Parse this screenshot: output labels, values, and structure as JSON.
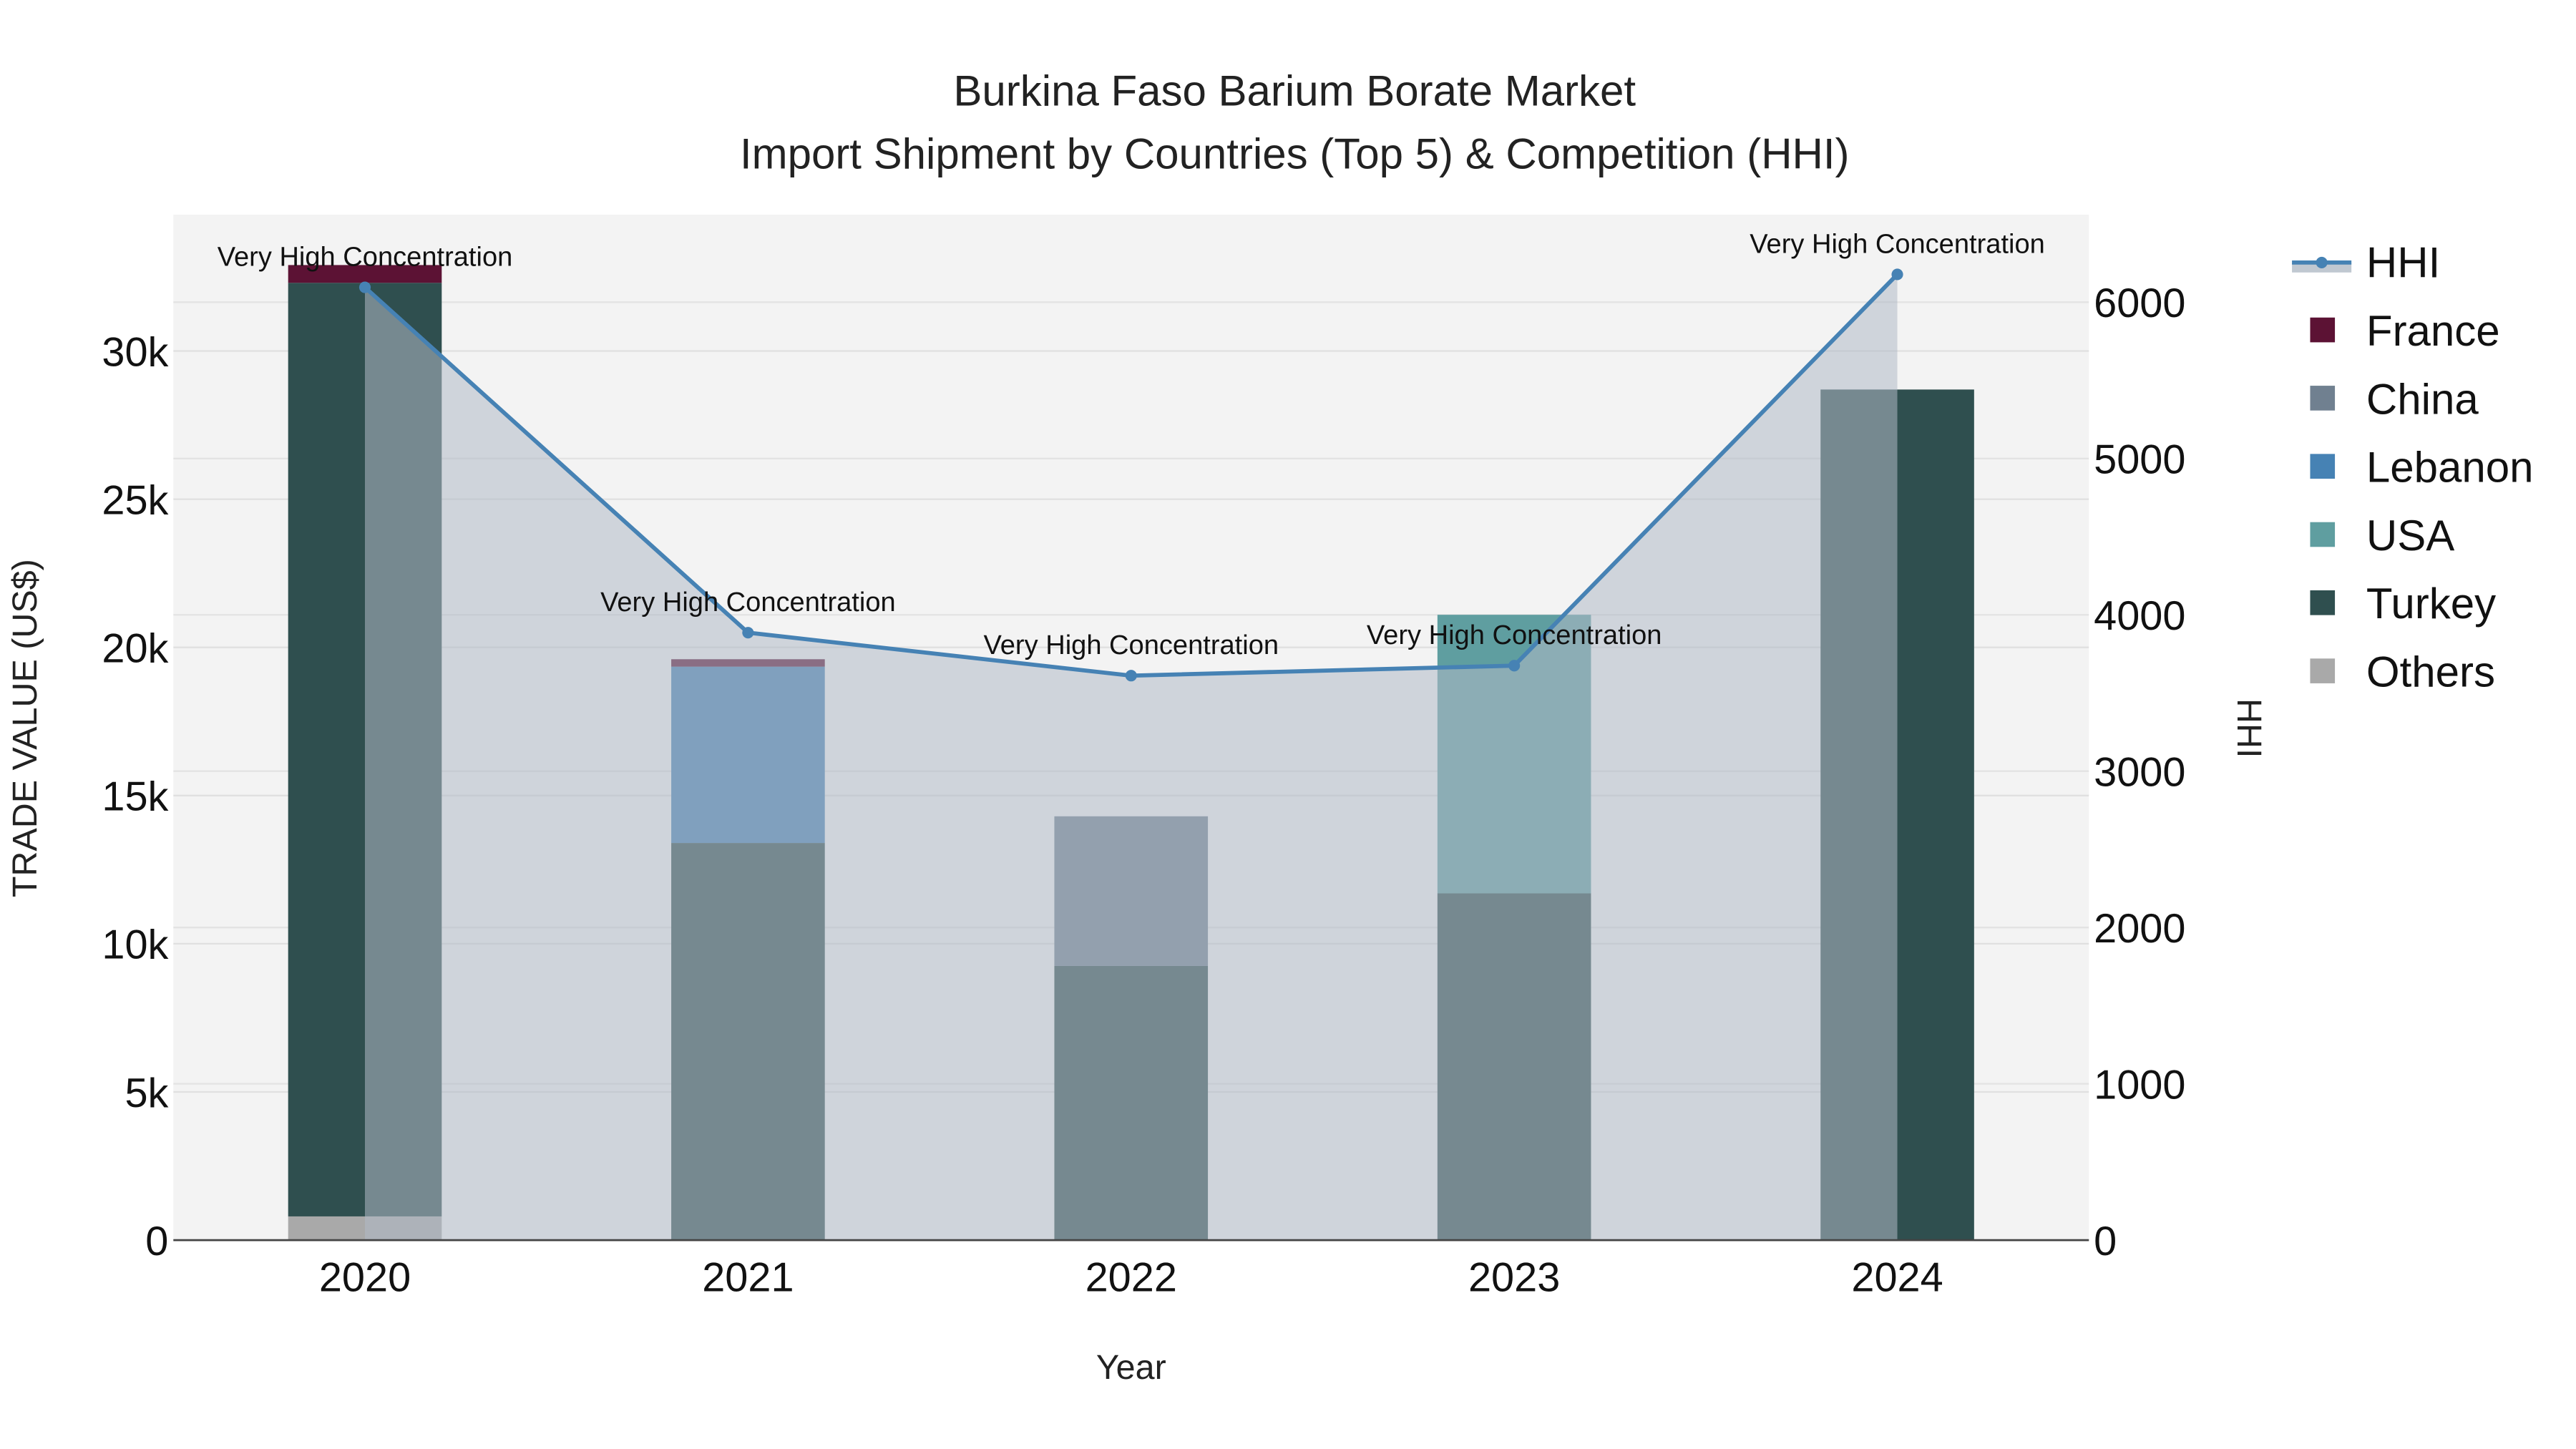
{
  "chart_data": {
    "type": "bar",
    "title": "Burkina Faso Barium Borate Market",
    "subtitle": "Import Shipment by Countries (Top 5) & Competition (HHI)",
    "xlabel": "Year",
    "ylabel": "TRADE VALUE (US$)",
    "y2label": "HHI",
    "categories": [
      "2020",
      "2021",
      "2022",
      "2023",
      "2024"
    ],
    "ylim": [
      0,
      34600
    ],
    "y2lim": [
      0,
      6560
    ],
    "yticks": [
      0,
      5000,
      10000,
      15000,
      20000,
      25000,
      30000
    ],
    "ytick_labels": [
      "0",
      "5k",
      "10k",
      "15k",
      "20k",
      "25k",
      "30k"
    ],
    "y2ticks": [
      0,
      1000,
      2000,
      3000,
      4000,
      5000,
      6000
    ],
    "y2tick_labels": [
      "0",
      "1000",
      "2000",
      "3000",
      "4000",
      "5000",
      "6000"
    ],
    "grid": true,
    "legend_placement": "right",
    "stacked": true,
    "series": [
      {
        "name": "Others",
        "color": "#a9a9a9",
        "values": [
          800,
          0,
          0,
          0,
          0
        ]
      },
      {
        "name": "Turkey",
        "color": "#2f4f4f",
        "values": [
          31500,
          13400,
          9250,
          11700,
          28700
        ]
      },
      {
        "name": "USA",
        "color": "#5f9ea0",
        "values": [
          0,
          0,
          0,
          9400,
          0
        ]
      },
      {
        "name": "Lebanon",
        "color": "#4682b4",
        "values": [
          0,
          5950,
          0,
          0,
          0
        ]
      },
      {
        "name": "China",
        "color": "#708090",
        "values": [
          0,
          0,
          5050,
          0,
          0
        ]
      },
      {
        "name": "France",
        "color": "#5c1234",
        "values": [
          600,
          250,
          0,
          0,
          0
        ]
      }
    ],
    "hhi": {
      "name": "HHI",
      "color": "#4682b4",
      "values": [
        6095,
        3886,
        3611,
        3675,
        6178
      ],
      "annotations": [
        "Very High Concentration",
        "Very High Concentration",
        "Very High Concentration",
        "Very High Concentration",
        "Very High Concentration"
      ]
    },
    "legend_order": [
      "HHI",
      "France",
      "China",
      "Lebanon",
      "USA",
      "Turkey",
      "Others"
    ]
  }
}
